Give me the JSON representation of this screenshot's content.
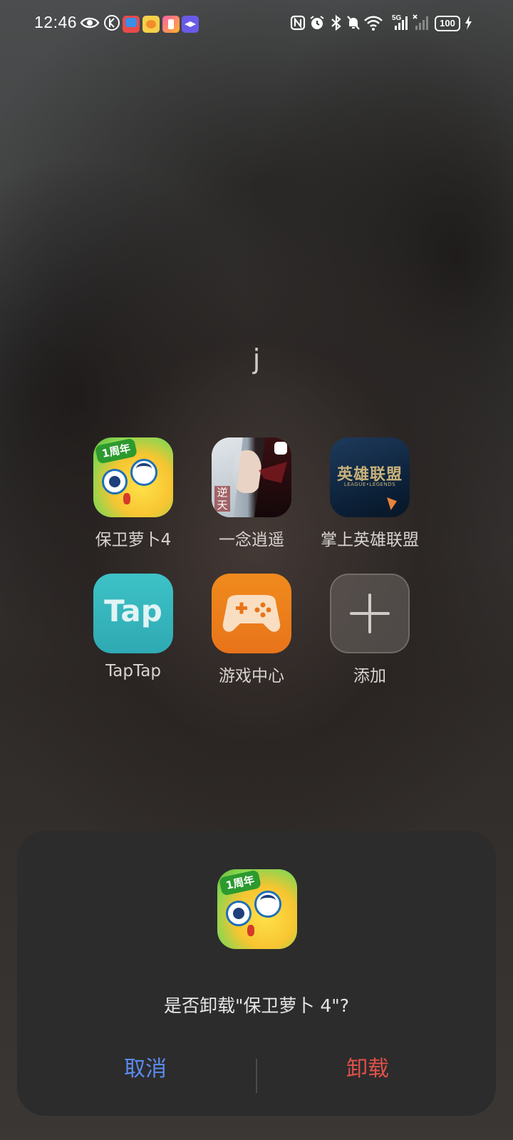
{
  "status_bar": {
    "time": "12:46",
    "battery": "100",
    "network": "5G",
    "icons": [
      "eye-icon",
      "k-icon",
      "notif-app-1",
      "notif-app-2",
      "notif-app-3",
      "notif-app-4",
      "nfc-icon",
      "alarm-icon",
      "bluetooth-icon",
      "mute-icon",
      "wifi-icon",
      "signal-icon",
      "signal-icon-2",
      "battery-icon",
      "charging-icon"
    ]
  },
  "folder": {
    "title": "j",
    "apps": [
      {
        "label": "保卫萝卜4",
        "icon": "luobo-icon"
      },
      {
        "label": "一念逍遥",
        "icon": "yinian-icon"
      },
      {
        "label": "掌上英雄联盟",
        "icon": "lol-icon"
      },
      {
        "label": "TapTap",
        "icon": "taptap-icon"
      },
      {
        "label": "游戏中心",
        "icon": "game-center-icon"
      },
      {
        "label": "添加",
        "icon": "add-icon"
      }
    ]
  },
  "icon_text": {
    "luobo_badge": "1周年",
    "yinian_vertical": "逆天",
    "lol_cn": "英雄联盟",
    "lol_en": "LEAGUE•LEGENDS",
    "taptap_logo": "Tap"
  },
  "dialog": {
    "message": "是否卸载\"保卫萝卜 4\"?",
    "cancel_label": "取消",
    "confirm_label": "卸载"
  },
  "colors": {
    "cancel": "#5b8bf0",
    "confirm": "#e0504a",
    "dialog_bg": "#2c2c2c"
  }
}
